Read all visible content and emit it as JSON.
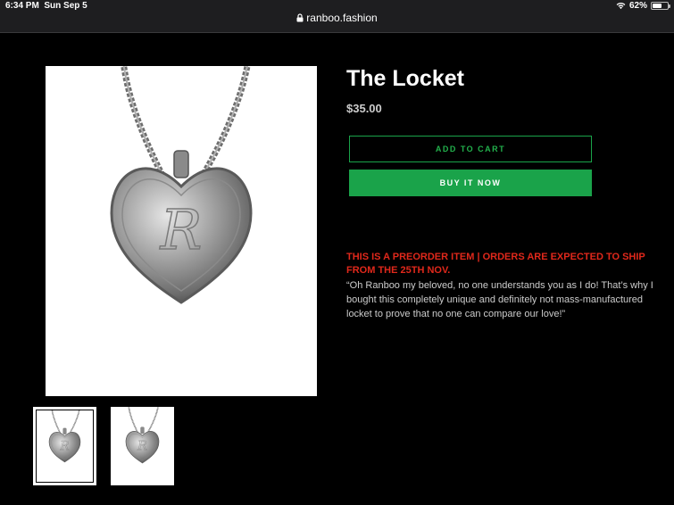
{
  "status_bar": {
    "time": "6:34 PM",
    "date": "Sun Sep 5",
    "battery_text": "62%",
    "battery_level": 0.62,
    "url": "ranboo.fashion"
  },
  "product": {
    "title": "The Locket",
    "price": "$35.00",
    "add_to_cart_label": "ADD TO CART",
    "buy_now_label": "BUY IT NOW",
    "notice": "THIS IS A PREORDER ITEM | ORDERS ARE EXPECTED TO SHIP FROM THE 25TH NOV.",
    "description": "“Oh Ranboo my beloved, no one understands you as I do! That’s why I bought this completely unique and definitely not mass-manufactured locket to prove that no one can compare our love!”"
  },
  "colors": {
    "background": "#000000",
    "accent_green": "#1aa34a",
    "notice_red": "#e0281b"
  },
  "icons": {
    "wifi": "wifi-icon",
    "battery": "battery-icon",
    "lock": "lock-icon"
  }
}
